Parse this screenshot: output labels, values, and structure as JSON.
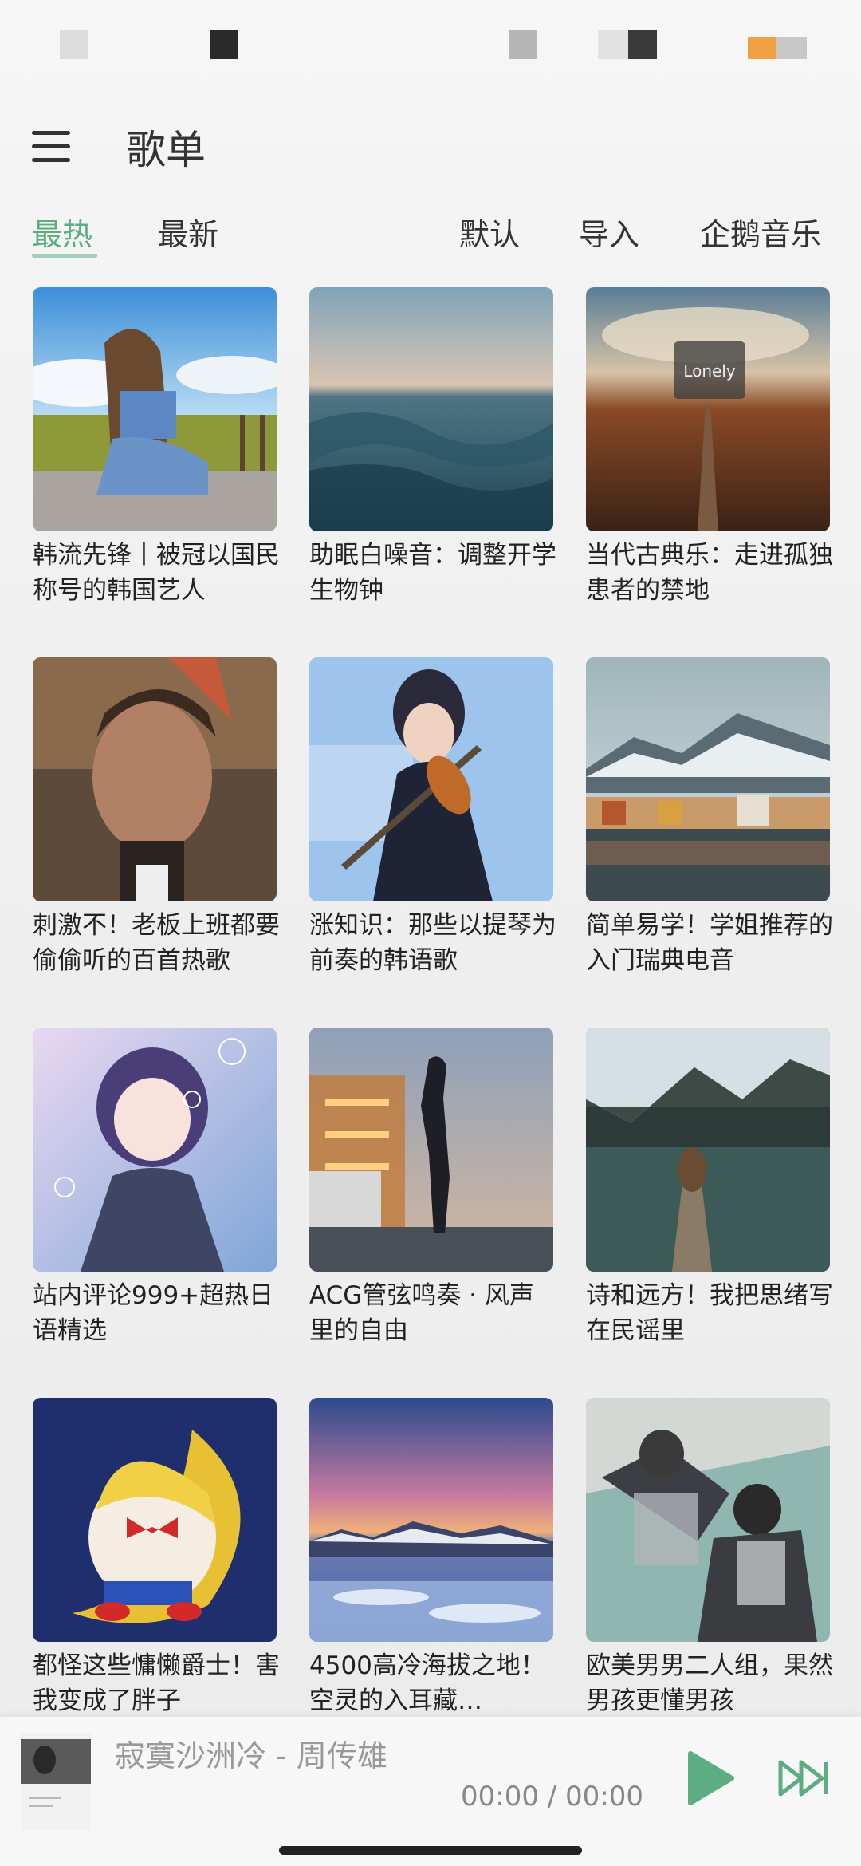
{
  "header": {
    "title": "歌单",
    "menu_icon": "hamburger-menu-icon"
  },
  "tabs": {
    "hot": "最热",
    "new": "最新",
    "default": "默认",
    "import": "导入",
    "source": "企鹅音乐",
    "active_color": "#5cae82"
  },
  "playlists": [
    {
      "title": "韩流先锋丨被冠以国民称号的韩国艺人"
    },
    {
      "title": "助眠白噪音：调整开学生物钟"
    },
    {
      "title": "当代古典乐：走进孤独患者的禁地",
      "cover_text": "Lonely"
    },
    {
      "title": "刺激不！老板上班都要偷偷听的百首热歌"
    },
    {
      "title": "涨知识：那些以提琴为前奏的韩语歌"
    },
    {
      "title": "简单易学！学姐推荐的入门瑞典电音"
    },
    {
      "title": "站内评论999+超热日语精选"
    },
    {
      "title": "ACG管弦鸣奏 · 风声里的自由"
    },
    {
      "title": "诗和远方！我把思绪写在民谣里"
    },
    {
      "title": "都怪这些慵懒爵士！害我变成了胖子"
    },
    {
      "title": "4500高冷海拔之地！空灵的入耳藏…"
    },
    {
      "title": "欧美男男二人组，果然男孩更懂男孩"
    }
  ],
  "player": {
    "now_playing": "寂寞沙洲冷 - 周传雄",
    "time": "00:00 / 00:00",
    "accent_color": "#5cae82"
  }
}
